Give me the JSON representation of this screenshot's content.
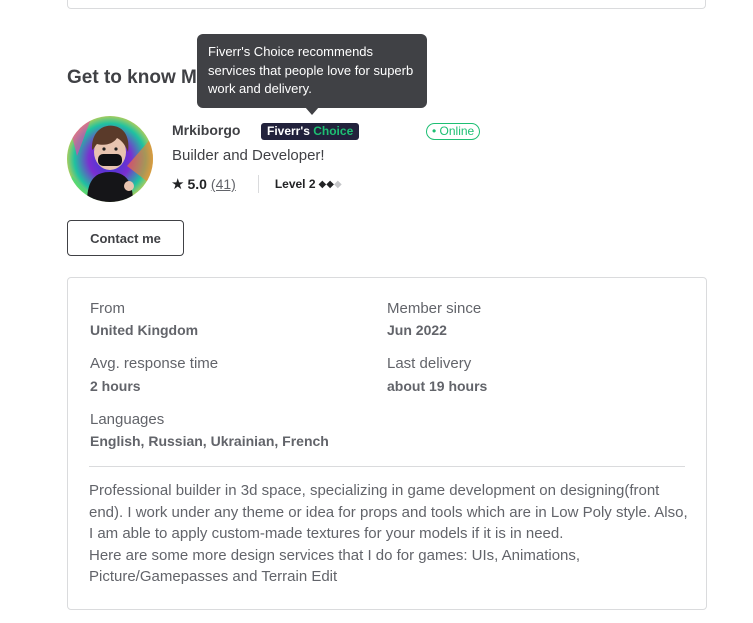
{
  "section_title": "Get to know Mrkiborgo",
  "tooltip": {
    "text": "Fiverr's Choice recommends services that people love for superb work and delivery."
  },
  "profile": {
    "username": "Mrkiborgo",
    "badge": {
      "part1": "Fiverr's",
      "part2": "Choice"
    },
    "status": "• Online",
    "tagline": "Builder and Developer!",
    "rating": "5.0",
    "reviews": "(41)",
    "level_label": "Level 2",
    "level": {
      "filled": 2,
      "total": 3
    }
  },
  "contact_button": "Contact me",
  "info": {
    "from_label": "From",
    "from_value": "United Kingdom",
    "member_label": "Member since",
    "member_value": "Jun 2022",
    "response_label": "Avg. response time",
    "response_value": "2 hours",
    "delivery_label": "Last delivery",
    "delivery_value": "about 19 hours",
    "languages_label": "Languages",
    "languages_value": "English, Russian, Ukrainian, French"
  },
  "description": {
    "paragraph1": "Professional builder in 3d space, specializing in game development on designing(front end). I work under any theme or idea for props and tools which are in Low Poly style. Also, I am able to apply custom-made textures for your models if it is in need.",
    "paragraph2": "Here are some more design services that I do for games: UIs, Animations, Picture/Gamepasses and Terrain Edit"
  },
  "colors": {
    "text": "#404145",
    "muted": "#62646a",
    "green": "#1dbf73",
    "badge_bg": "#22223c",
    "tooltip_bg": "#404145",
    "border": "#dadbdd"
  }
}
